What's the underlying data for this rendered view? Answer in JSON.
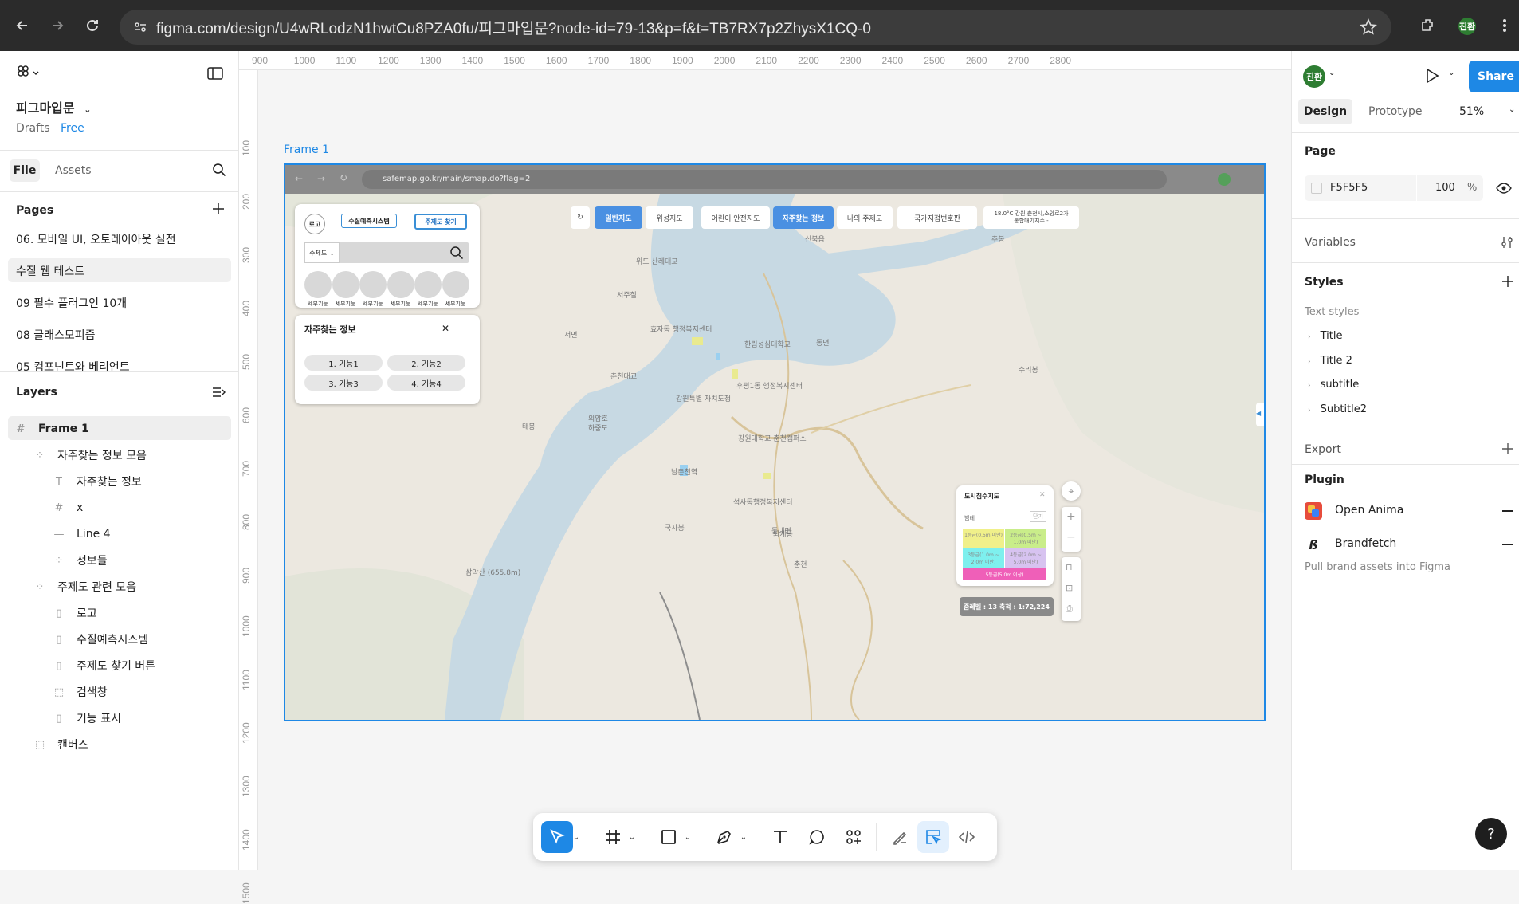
{
  "browser": {
    "url": "figma.com/design/U4wRLodzN1hwtCu8PZA0fu/피그마입문?node-id=79-13&p=f&t=TB7RX7p2ZhysX1CQ-0",
    "profile": "진환"
  },
  "left_panel": {
    "file_name": "피그마입문",
    "drafts": "Drafts",
    "plan": "Free",
    "tabs": [
      "File",
      "Assets"
    ],
    "pages_title": "Pages",
    "pages": [
      "06. 모바일 UI, 오토레이아웃 실전",
      "수질 웹 테스트",
      "09 필수 플러그인 10개",
      "08 글래스모피즘",
      "05 컴포넌트와 베리언트"
    ],
    "layers_title": "Layers",
    "layers": [
      {
        "name": "Frame 1",
        "icon": "frame-icon"
      },
      {
        "name": "자주찾는 정보 모음",
        "icon": "group-icon"
      },
      {
        "name": "자주찾는 정보",
        "icon": "text-icon"
      },
      {
        "name": "x",
        "icon": "frame-icon"
      },
      {
        "name": "Line 4",
        "icon": "line-icon"
      },
      {
        "name": "정보들",
        "icon": "group-icon"
      },
      {
        "name": "주제도 관련 모음",
        "icon": "group-icon"
      },
      {
        "name": "로고",
        "icon": "component-icon"
      },
      {
        "name": "수질예측시스템",
        "icon": "component-icon"
      },
      {
        "name": "주제도 찾기 버튼",
        "icon": "component-icon"
      },
      {
        "name": "검색창",
        "icon": "rect-icon"
      },
      {
        "name": "기능 표시",
        "icon": "component-icon"
      },
      {
        "name": "캔버스",
        "icon": "rect-icon"
      }
    ]
  },
  "rulers": {
    "top": [
      "900",
      "1000",
      "1100",
      "1200",
      "1300",
      "1400",
      "1500",
      "1600",
      "1700",
      "1800",
      "1900",
      "2000",
      "2100",
      "2200",
      "2300",
      "2400",
      "2500",
      "2600",
      "2700",
      "2800"
    ],
    "left": [
      "100",
      "200",
      "300",
      "400",
      "500",
      "600",
      "700",
      "800",
      "900",
      "1000",
      "1100",
      "1200",
      "1300",
      "1400",
      "1500"
    ]
  },
  "canvas": {
    "frame_label": "Frame 1",
    "inner_url": "safemap.go.kr/main/smap.do?flag=2",
    "panel": {
      "logo": "로고",
      "system": "수질예측시스템",
      "find_button": "주제도 찾기",
      "select": "주제도",
      "features": [
        "세부기능",
        "세부기능",
        "세부기능",
        "세부기능",
        "세부기능",
        "세부기능"
      ]
    },
    "faq": {
      "title": "자주찾는 정보",
      "items": [
        "1. 기능1",
        "2. 기능2",
        "3. 기능3",
        "4. 기능4"
      ]
    },
    "map_tabs": [
      "일반지도",
      "위성지도",
      "어린이 안전지도",
      "자주찾는 정보",
      "나의 주제도",
      "국가지점번호판"
    ],
    "weather": "18.0°C 강원,춘천시,소양로2가",
    "weather2": "통합대기지수 -",
    "legend": {
      "title": "도시침수지도",
      "sub": "범례",
      "close": "닫기",
      "cells": [
        "1등급(0.5m 미만)",
        "2등급(0.5m ~ 1.0m 미만)",
        "3등급(1.0m ~ 2.0m 미만)",
        "4등급(2.0m ~ 5.0m 미만)",
        "5등급(5.0m 이상)"
      ]
    },
    "scale": "줌레벨 : 13  축척 : 1:72,224",
    "map_labels": [
      "위도 산레대교",
      "서주칠",
      "서면",
      "춘천대교",
      "의암호",
      "태봉",
      "하중도",
      "효자동 행정복지센터",
      "강원특별 자치도청",
      "강원대학교 춘천캠퍼스",
      "석사동행정복지센터",
      "남춘천역",
      "국사봉",
      "퇴계동",
      "삼악산 (655.8m)",
      "동면",
      "한림성심대학교",
      "수리봉",
      "추봉",
      "신북읍",
      "후평1동 행정복지센터",
      "동내면",
      "춘천"
    ]
  },
  "right_panel": {
    "tabs": [
      "Design",
      "Prototype"
    ],
    "zoom": "51%",
    "share": "Share",
    "page_title": "Page",
    "bg_hex": "F5F5F5",
    "bg_opacity": "100",
    "pct": "%",
    "variables": "Variables",
    "styles": "Styles",
    "text_styles": "Text styles",
    "style_items": [
      "Title",
      "Title 2",
      "subtitle",
      "Subtitle2"
    ],
    "export": "Export",
    "plugin": "Plugin",
    "plugins": [
      "Open Anima",
      "Brandfetch"
    ],
    "plugin_desc": "Pull brand assets into Figma"
  },
  "help": "?"
}
